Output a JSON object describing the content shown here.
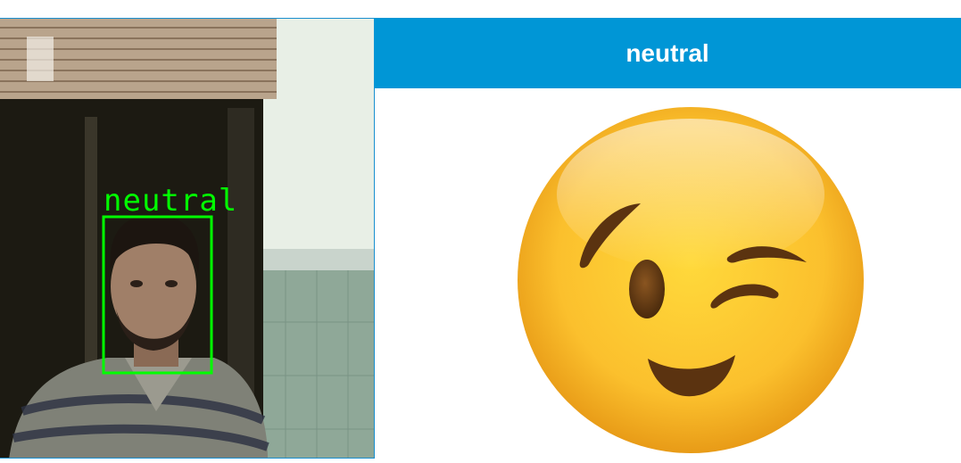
{
  "webcam": {
    "detected_label": "neutral",
    "box_color": "#00ff00"
  },
  "result": {
    "emotion_title": "neutral",
    "header_color": "#0096d6",
    "emoji_icon": "winking-face-icon"
  }
}
